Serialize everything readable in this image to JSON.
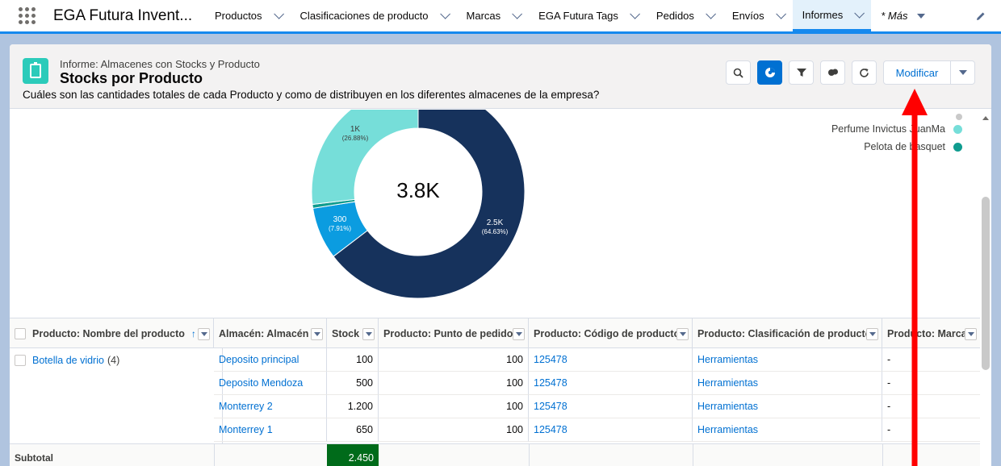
{
  "app": {
    "name": "EGA Futura Invent..."
  },
  "nav": {
    "items": [
      {
        "label": "Productos"
      },
      {
        "label": "Clasificaciones de producto"
      },
      {
        "label": "Marcas"
      },
      {
        "label": "EGA Futura Tags"
      },
      {
        "label": "Pedidos"
      },
      {
        "label": "Envíos"
      },
      {
        "label": "Informes"
      }
    ],
    "more_label": "* Más"
  },
  "report": {
    "subtitle": "Informe: Almacenes con Stocks y Producto",
    "title": "Stocks por Producto",
    "description": "Cuáles son las cantidades totales de cada Producto y como de distribuyen en los diferentes almacenes de la empresa?",
    "modify_label": "Modificar"
  },
  "colors": {
    "accent": "#0070d2",
    "dark_navy": "#16325c",
    "teal_light": "#76ded9",
    "teal_dark": "#0f9c8f",
    "blue": "#0b9ce0",
    "subtotal_green": "#006b1a",
    "annotation_red": "#ff0000"
  },
  "chart_data": {
    "type": "pie",
    "center_label": "3.8K",
    "slices": [
      {
        "label": "2.5K",
        "percent_label": "(64.63%)",
        "value": 2450,
        "percent": 64.63,
        "color": "#16325c"
      },
      {
        "label": "300",
        "percent_label": "(7.91%)",
        "value": 300,
        "percent": 7.91,
        "color": "#0b9ce0"
      },
      {
        "value": 25,
        "percent": 0.58,
        "color": "#0f9c8f"
      },
      {
        "label": "1K",
        "percent_label": "(26.88%)",
        "value": 1019,
        "percent": 26.88,
        "color": "#76ded9"
      }
    ],
    "legend": [
      {
        "label": "Perfume Invictus JuanMa",
        "color": "#76ded9"
      },
      {
        "label": "Pelota de basquet",
        "color": "#0f9c8f"
      }
    ]
  },
  "table": {
    "columns": [
      "Producto: Nombre del producto",
      "Almacén: Almacén",
      "Stock",
      "Producto: Punto de pedido",
      "Producto: Código de producto",
      "Producto: Clasificación de producto",
      "Producto: Marca"
    ],
    "sort_arrow": "↑",
    "group": {
      "name": "Botella de vidrio",
      "count": "(4)"
    },
    "rows": [
      {
        "almacen": "Deposito principal",
        "stock": "100",
        "punto": "100",
        "codigo": "125478",
        "clasif": "Herramientas",
        "marca": "-"
      },
      {
        "almacen": "Deposito Mendoza",
        "stock": "500",
        "punto": "100",
        "codigo": "125478",
        "clasif": "Herramientas",
        "marca": "-"
      },
      {
        "almacen": "Monterrey 2",
        "stock": "1.200",
        "punto": "100",
        "codigo": "125478",
        "clasif": "Herramientas",
        "marca": "-"
      },
      {
        "almacen": "Monterrey 1",
        "stock": "650",
        "punto": "100",
        "codigo": "125478",
        "clasif": "Herramientas",
        "marca": "-"
      }
    ],
    "subtotal_label": "Subtotal",
    "subtotal_value": "2.450"
  }
}
